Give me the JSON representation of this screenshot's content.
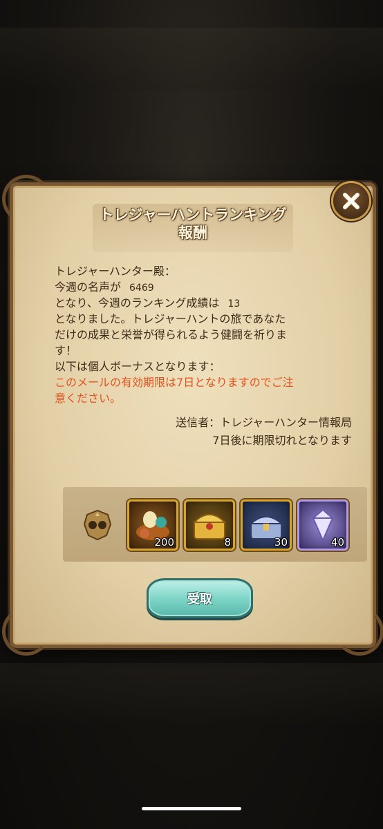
{
  "dialog": {
    "title_line1": "トレジャーハントランキング",
    "title_line2": "報酬",
    "message": {
      "line1": "トレジャーハンター殿：",
      "line2_prefix": "今週の名声が",
      "fame_value": "6469",
      "line3_prefix": "となり、今週のランキング成績は",
      "rank_value": "13",
      "line4": "となりました。トレジャーハントの旅であなた",
      "line5": "だけの成果と栄誉が得られるよう健闘を祈りま",
      "line6": "す！",
      "line7": "以下は個人ボーナスとなります：",
      "warning_line1": "このメールの有効期限は7日となりますのでご注",
      "warning_line2": "意ください。"
    },
    "sender": "送信者：トレジャーハンター情報局",
    "expiry": "7日後に期限切れとなります",
    "rewards": [
      {
        "icon": "bird-pet-food-icon",
        "count": "200"
      },
      {
        "icon": "golden-chest-icon",
        "count": "8"
      },
      {
        "icon": "silver-chest-icon",
        "count": "30"
      },
      {
        "icon": "crystal-gem-icon",
        "count": "40"
      }
    ],
    "receive_label": "受取",
    "colors": {
      "warning_text": "#e2531f",
      "body_text": "#3c2a18",
      "parchment": "#e8d6b0",
      "button_teal": "#7fd6c8"
    }
  }
}
